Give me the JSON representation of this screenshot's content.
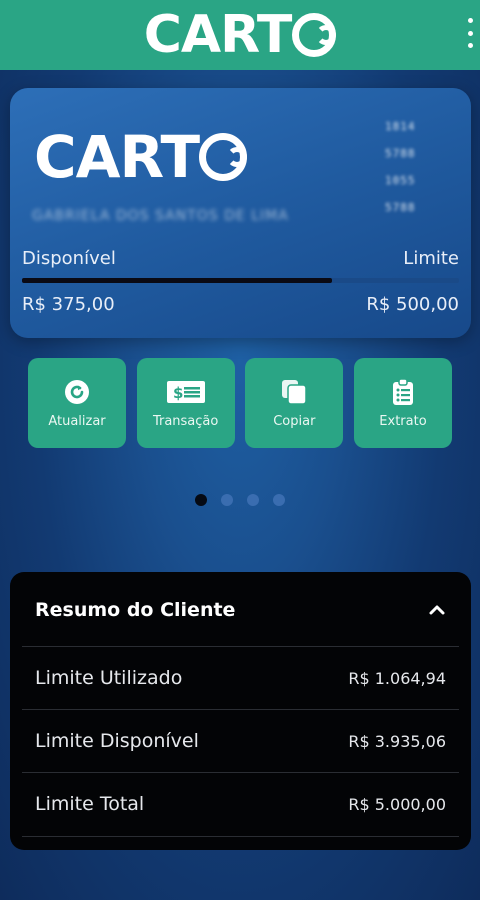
{
  "header": {
    "logo": "CARTO"
  },
  "card": {
    "logo": "CARTO",
    "number_groups": [
      "1814",
      "5788",
      "1055",
      "5788"
    ],
    "holder": "GABRIELA DOS SANTOS DE LIMA",
    "available_label": "Disponível",
    "limit_label": "Limite",
    "available_value": "R$ 375,00",
    "limit_value": "R$ 500,00",
    "used_fraction": 0.71
  },
  "actions": [
    {
      "label": "Atualizar",
      "icon": "refresh-icon"
    },
    {
      "label": "Transação",
      "icon": "money-icon"
    },
    {
      "label": "Copiar",
      "icon": "copy-icon"
    },
    {
      "label": "Extrato",
      "icon": "clipboard-icon"
    }
  ],
  "carousel": {
    "pages": 4,
    "active": 0
  },
  "summary": {
    "title": "Resumo do Cliente",
    "rows": [
      {
        "label": "Limite Utilizado",
        "value": "R$ 1.064,94"
      },
      {
        "label": "Limite Disponível",
        "value": "R$ 3.935,06"
      },
      {
        "label": "Limite Total",
        "value": "R$ 5.000,00"
      }
    ]
  },
  "colors": {
    "accent": "#2aa585",
    "card": "#205ba0",
    "panel": "#030406"
  }
}
